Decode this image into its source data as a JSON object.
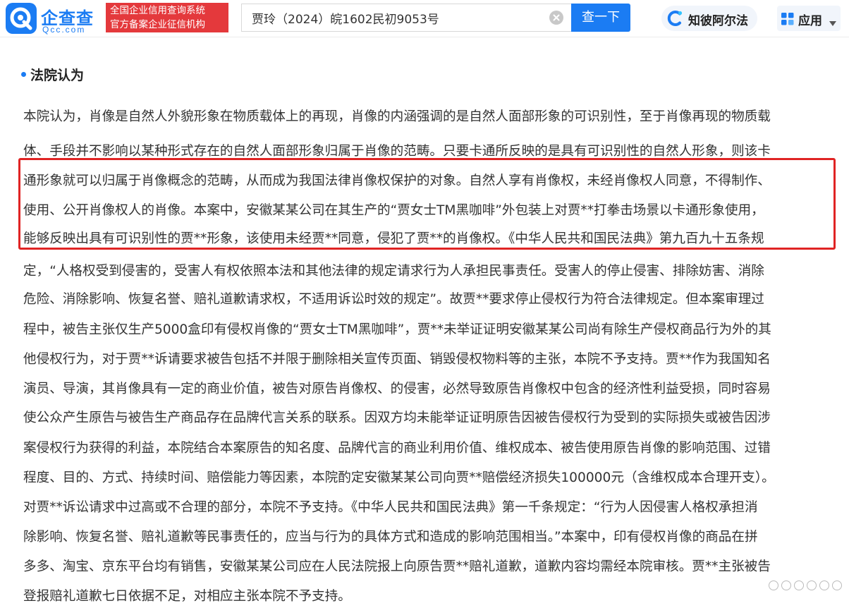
{
  "header": {
    "logo_name": "企查查",
    "logo_domain": "Qcc.com",
    "badge_line1": "全国企业信用查询系统",
    "badge_line2": "官方备案企业征信机构",
    "search_value": "贾玲（2024）皖1602民初9053号",
    "search_button": "查一下",
    "ai_label": "知彼阿尔法",
    "app_menu_label": "应用"
  },
  "section": {
    "title": "法院认为"
  },
  "body_lines": [
    "本院认为，肖像是自然人外貌形象在物质载体上的再现，肖像的内涵强调的是自然人面部形象的可识别性，至于肖像再现的物质载",
    "体、手段并不影响以某种形式存在的自然人面部形象归属于肖像的范畴。只要卡通所反映的是具有可识别性的自然人形象，则该卡",
    "通形象就可以归属于肖像概念的范畴，从而成为我国法律肖像权保护的对象。自然人享有肖像权，未经肖像权人同意，不得制作、",
    "使用、公开肖像权人的肖像。本案中，安徽某某公司在其生产的“贾女士TM黑咖啡”外包装上对贾**打拳击场景以卡通形象使用，",
    "能够反映出具有可识别性的贾**形象，该使用未经贾**同意，侵犯了贾**的肖像权。《中华人民共和国民法典》第九百九十五条规",
    "定，“人格权受到侵害的，受害人有权依照本法和其他法律的规定请求行为人承担民事责任。受害人的停止侵害、排除妨害、消除",
    "危险、消除影响、恢复名誉、赔礼道歉请求权，不适用诉讼时效的规定”。故贾**要求停止侵权行为符合法律规定。但本案审理过",
    "程中，被告主张仅生产5000盒印有侵权肖像的“贾女士TM黑咖啡”，贾**未举证证明安徽某某公司尚有除生产侵权商品行为外的其",
    "他侵权行为，对于贾**诉请要求被告包括不并限于删除相关宣传页面、销毁侵权物料等的主张，本院不予支持。贾**作为我国知名",
    "演员、导演，其肖像具有一定的商业价值，被告对原告肖像权、的侵害，必然导致原告肖像权中包含的经济性利益受损，同时容易",
    "使公众产生原告与被告生产商品存在品牌代言关系的联系。因双方均未能举证证明原告因被告侵权行为受到的实际损失或被告因涉",
    "案侵权行为获得的利益，本院结合本案原告的知名度、品牌代言的商业利用价值、维权成本、被告使用原告肖像的影响范围、过错",
    "程度、目的、方式、持续时间、赔偿能力等因素，本院酌定安徽某某公司向贾**赔偿经济损失100000元（含维权成本合理开支）。",
    "对贾**诉讼请求中过高或不合理的部分，本院不予支持。《中华人民共和国民法典》第一千条规定：“行为人因侵害人格权承担消",
    "除影响、恢复名誉、赔礼道歉等民事责任的，应当与行为的具体方式和造成的影响范围相当。”本案中，印有侵权肖像的商品在拼",
    "多多、淘宝、京东平台均有销售，安徽某某公司应在人民法院报上向原告贾**赔礼道歉，道歉内容均需经本院审核。贾**主张被告",
    "登报赔礼道歉七日依据不足，对相应主张本院不予支持。"
  ],
  "colors": {
    "brand_blue": "#1b7cf3",
    "badge_red": "#e4393c",
    "highlight_red": "#e02424"
  },
  "icons": {
    "logo": "qcc-logo-icon",
    "clear": "clear-icon",
    "ai": "ai-c-icon",
    "app": "app-grid-icon",
    "chevron": "chevron-down-icon"
  }
}
